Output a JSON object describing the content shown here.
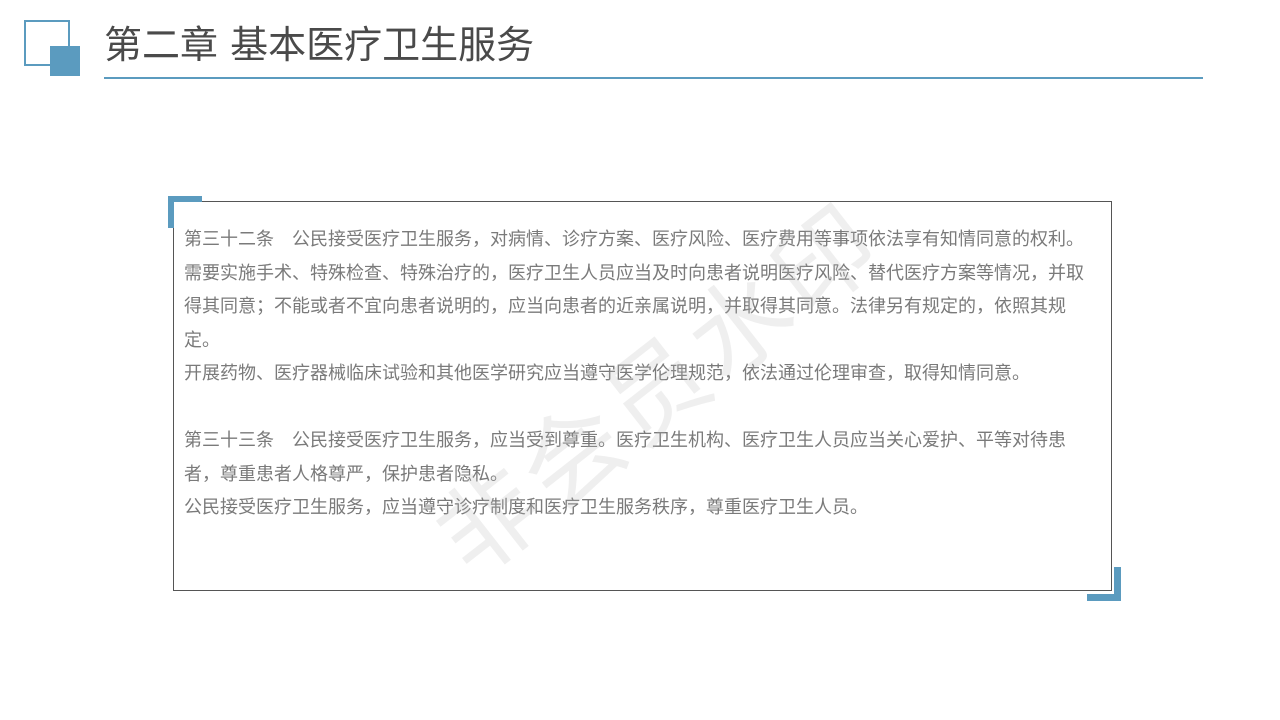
{
  "header": {
    "title": "第二章 基本医疗卫生服务"
  },
  "content": {
    "paragraphs": [
      "第三十二条　公民接受医疗卫生服务，对病情、诊疗方案、医疗风险、医疗费用等事项依法享有知情同意的权利。",
      "需要实施手术、特殊检查、特殊治疗的，医疗卫生人员应当及时向患者说明医疗风险、替代医疗方案等情况，并取得其同意；不能或者不宜向患者说明的，应当向患者的近亲属说明，并取得其同意。法律另有规定的，依照其规定。",
      "开展药物、医疗器械临床试验和其他医学研究应当遵守医学伦理规范，依法通过伦理审查，取得知情同意。",
      "第三十三条　公民接受医疗卫生服务，应当受到尊重。医疗卫生机构、医疗卫生人员应当关心爱护、平等对待患者，尊重患者人格尊严，保护患者隐私。",
      "公民接受医疗卫生服务，应当遵守诊疗制度和医疗卫生服务秩序，尊重医疗卫生人员。"
    ]
  },
  "watermark": {
    "text": "非会员水印"
  },
  "colors": {
    "accent": "#5b9bbf",
    "title_text": "#4a4a4a",
    "body_text": "#7a7a7a",
    "box_border": "#555555"
  }
}
